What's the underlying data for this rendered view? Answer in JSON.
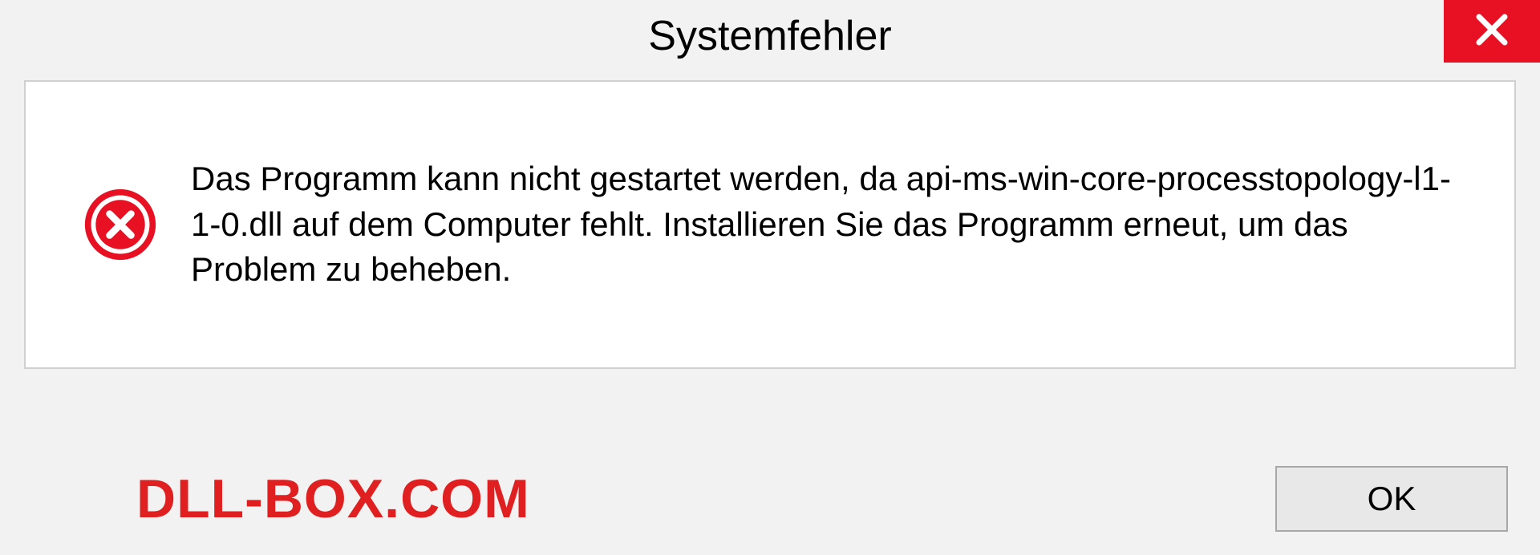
{
  "dialog": {
    "title": "Systemfehler",
    "message": "Das Programm kann nicht gestartet werden, da api-ms-win-core-processtopology-l1-1-0.dll auf dem Computer fehlt. Installieren Sie das Programm erneut, um das Problem zu beheben.",
    "ok_label": "OK"
  },
  "watermark": "DLL-BOX.COM"
}
